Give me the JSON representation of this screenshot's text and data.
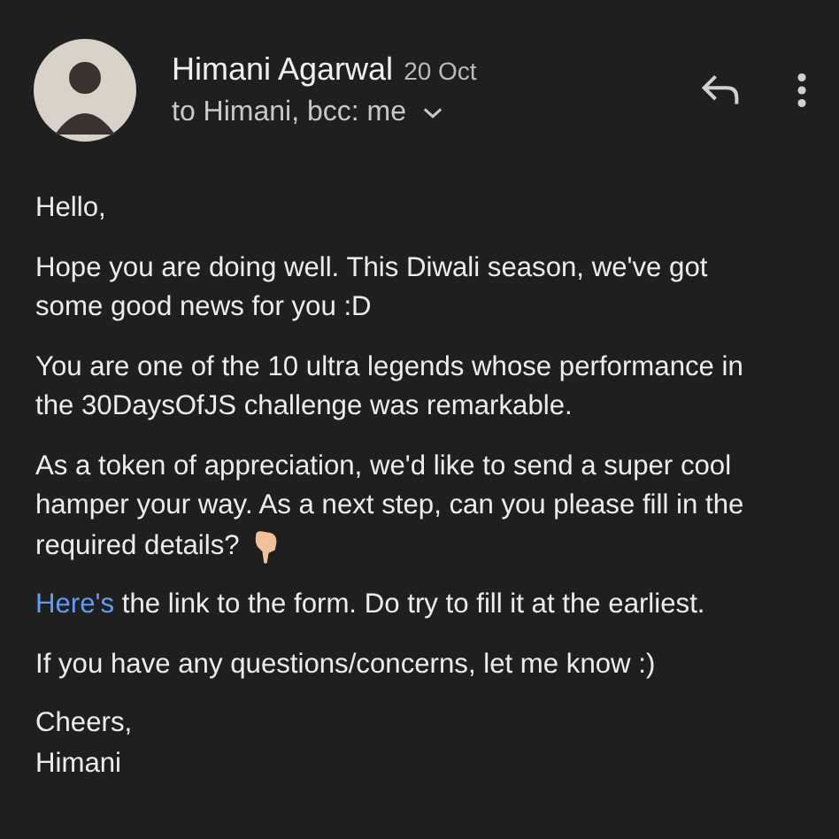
{
  "header": {
    "sender": "Himani Agarwal",
    "date": "20 Oct",
    "recipients": "to Himani, bcc: me"
  },
  "body": [
    {
      "kind": "text",
      "lines": [
        "Hello,"
      ]
    },
    {
      "kind": "text",
      "lines": [
        "Hope you are doing well. This Diwali season, we've got",
        "some good news for you :D"
      ]
    },
    {
      "kind": "text",
      "lines": [
        "You are one of the 10 ultra legends whose performance in",
        "the 30DaysOfJS challenge was remarkable."
      ]
    },
    {
      "kind": "emoji",
      "lines": [
        "As a token of appreciation, we'd like to send a super cool",
        "hamper your way. As a next step, can you please fill in the",
        "required details?"
      ]
    },
    {
      "kind": "link",
      "link": "Here's",
      "text": " the link to the form. Do try to fill it at the earliest."
    },
    {
      "kind": "text",
      "lines": [
        "If you have any questions/concerns, let me know :)"
      ]
    },
    {
      "kind": "text",
      "lines": [
        "Cheers,",
        "Himani"
      ]
    }
  ]
}
